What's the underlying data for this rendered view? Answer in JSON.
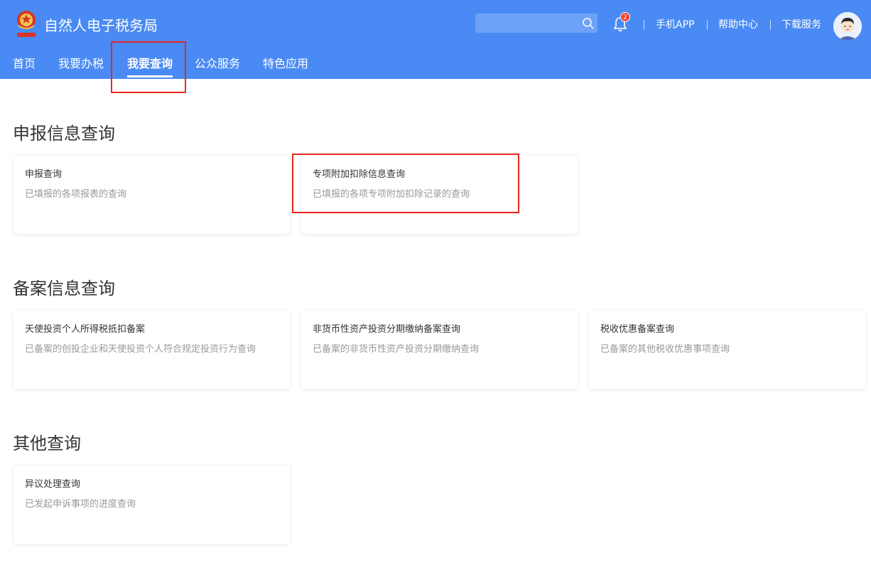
{
  "header": {
    "title": "自然人电子税务局",
    "search": {
      "placeholder": ""
    },
    "notifications": {
      "count": "2"
    },
    "links": [
      "手机APP",
      "帮助中心",
      "下载服务"
    ]
  },
  "nav": {
    "items": [
      "首页",
      "我要办税",
      "我要查询",
      "公众服务",
      "特色应用"
    ],
    "active_index": 2
  },
  "sections": [
    {
      "title": "申报信息查询",
      "cards": [
        {
          "title": "申报查询",
          "desc": "已填报的各项报表的查询"
        },
        {
          "title": "专项附加扣除信息查询",
          "desc": "已填报的各项专项附加扣除记录的查询"
        }
      ]
    },
    {
      "title": "备案信息查询",
      "cards": [
        {
          "title": "天使投资个人所得税抵扣备案",
          "desc": "已备案的创投企业和天使投资个人符合规定投资行为查询"
        },
        {
          "title": "非货币性资产投资分期缴纳备案查询",
          "desc": "已备案的非货币性资产投资分期缴纳查询"
        },
        {
          "title": "税收优惠备案查询",
          "desc": "已备案的其他税收优惠事项查询"
        }
      ]
    },
    {
      "title": "其他查询",
      "cards": [
        {
          "title": "异议处理查询",
          "desc": "已发起申诉事项的进度查询"
        }
      ]
    }
  ],
  "colors": {
    "header_bg": "#4a8af4",
    "highlight": "#e8271f",
    "badge": "#f04134"
  }
}
